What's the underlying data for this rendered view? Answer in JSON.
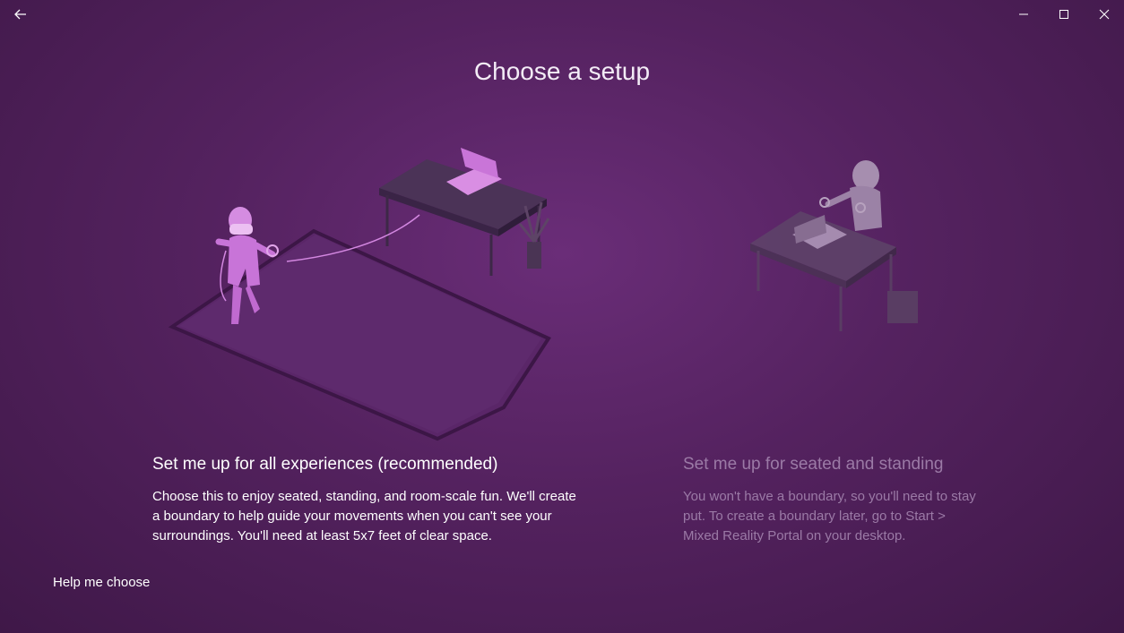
{
  "window": {
    "back_icon": "arrow-left-icon",
    "minimize_icon": "minimize-icon",
    "maximize_icon": "maximize-icon",
    "close_icon": "close-icon"
  },
  "page": {
    "title": "Choose a setup"
  },
  "options": [
    {
      "heading": "Set me up for all experiences (recommended)",
      "body": "Choose this to enjoy seated, standing, and room-scale fun. We'll create a boundary to help guide your movements when you can't see your surroundings. You'll need at least 5x7 feet of clear space.",
      "state": "enabled"
    },
    {
      "heading": "Set me up for seated and standing",
      "body": "You won't have a boundary, so you'll need to stay put. To create a boundary later, go to Start > Mixed Reality Portal on your desktop.",
      "state": "dimmed"
    }
  ],
  "help_link": "Help me choose",
  "colors": {
    "background": "#54225f",
    "text_primary": "#ffffff",
    "text_dimmed": "#9b7aa6",
    "accent_figure": "#d07ee0"
  }
}
